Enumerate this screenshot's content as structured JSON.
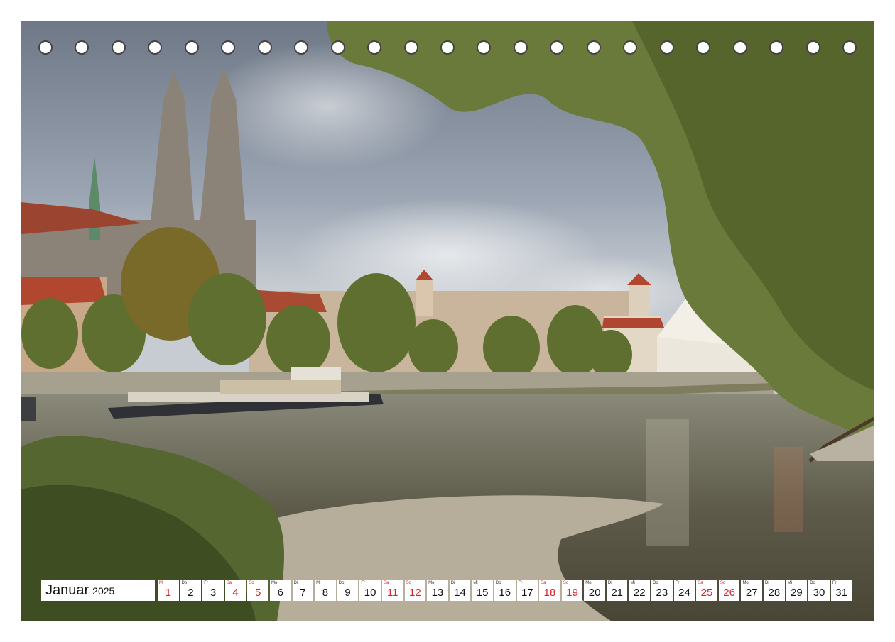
{
  "calendar": {
    "month": "Januar",
    "year": "2025",
    "weekend_color": "#d4242a",
    "days": [
      {
        "wd": "Mi",
        "n": "1",
        "weekend": true
      },
      {
        "wd": "Do",
        "n": "2",
        "weekend": false
      },
      {
        "wd": "Fr",
        "n": "3",
        "weekend": false
      },
      {
        "wd": "Sa",
        "n": "4",
        "weekend": true
      },
      {
        "wd": "So",
        "n": "5",
        "weekend": true
      },
      {
        "wd": "Mo",
        "n": "6",
        "weekend": false
      },
      {
        "wd": "Di",
        "n": "7",
        "weekend": false
      },
      {
        "wd": "Mi",
        "n": "8",
        "weekend": false
      },
      {
        "wd": "Do",
        "n": "9",
        "weekend": false
      },
      {
        "wd": "Fr",
        "n": "10",
        "weekend": false
      },
      {
        "wd": "Sa",
        "n": "11",
        "weekend": true
      },
      {
        "wd": "So",
        "n": "12",
        "weekend": true
      },
      {
        "wd": "Mo",
        "n": "13",
        "weekend": false
      },
      {
        "wd": "Di",
        "n": "14",
        "weekend": false
      },
      {
        "wd": "Mi",
        "n": "15",
        "weekend": false
      },
      {
        "wd": "Do",
        "n": "16",
        "weekend": false
      },
      {
        "wd": "Fr",
        "n": "17",
        "weekend": false
      },
      {
        "wd": "Sa",
        "n": "18",
        "weekend": true
      },
      {
        "wd": "So",
        "n": "19",
        "weekend": true
      },
      {
        "wd": "Mo",
        "n": "20",
        "weekend": false
      },
      {
        "wd": "Di",
        "n": "21",
        "weekend": false
      },
      {
        "wd": "Mi",
        "n": "22",
        "weekend": false
      },
      {
        "wd": "Do",
        "n": "23",
        "weekend": false
      },
      {
        "wd": "Fr",
        "n": "24",
        "weekend": false
      },
      {
        "wd": "Sa",
        "n": "25",
        "weekend": true
      },
      {
        "wd": "So",
        "n": "26",
        "weekend": true
      },
      {
        "wd": "Mo",
        "n": "27",
        "weekend": false
      },
      {
        "wd": "Di",
        "n": "28",
        "weekend": false
      },
      {
        "wd": "Mi",
        "n": "29",
        "weekend": false
      },
      {
        "wd": "Do",
        "n": "30",
        "weekend": false
      },
      {
        "wd": "Fr",
        "n": "31",
        "weekend": false
      }
    ]
  },
  "colors": {
    "sky": "#8a96a6",
    "cloud": "#d9dde2",
    "river": "#6e6a58",
    "foliage": "#6f7a3a",
    "roof": "#b2472f",
    "cathedral": "#8a8276"
  },
  "binding_holes": 23
}
